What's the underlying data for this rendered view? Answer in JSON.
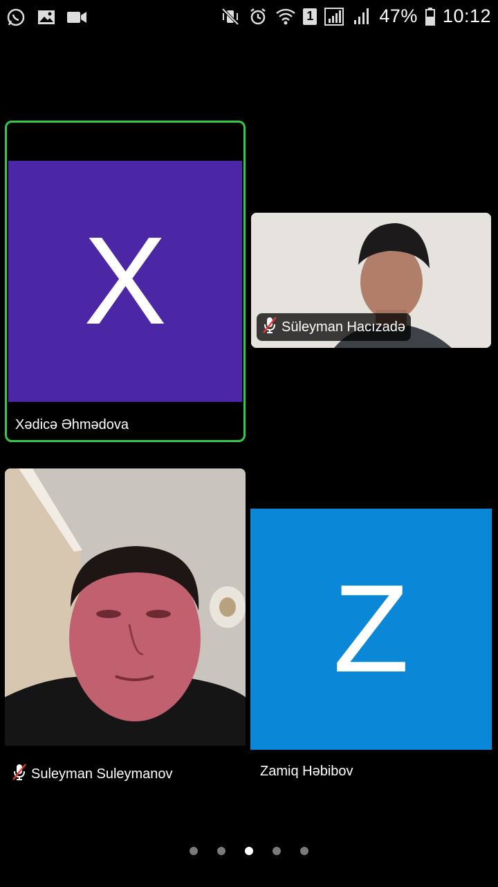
{
  "status_bar": {
    "battery_percent": "47%",
    "time": "10:12",
    "sim_badge": "1",
    "left_icons": [
      "whatsapp-icon",
      "gallery-icon",
      "video-camera-icon"
    ],
    "right_icons": [
      "vibrate-mute-icon",
      "alarm-icon",
      "wifi-icon",
      "signal-icon",
      "battery-icon"
    ]
  },
  "participants": [
    {
      "name": "Xədicə Əhmədova",
      "initial": "X",
      "avatar_color": "#4b27a6",
      "active_speaker": true,
      "muted": false
    },
    {
      "name": "Süleyman Hacızadə",
      "video": true,
      "muted": true
    },
    {
      "name": "Suleyman Suleymanov",
      "video": true,
      "muted": true
    },
    {
      "name": "Zamiq Həbibov",
      "initial": "Z",
      "avatar_color": "#0a87d6",
      "muted": false
    }
  ],
  "pagination": {
    "pages": 5,
    "current_page": 3
  },
  "colors": {
    "active_speaker_border": "#35c84b",
    "mute_icon_slash": "#e53935"
  }
}
